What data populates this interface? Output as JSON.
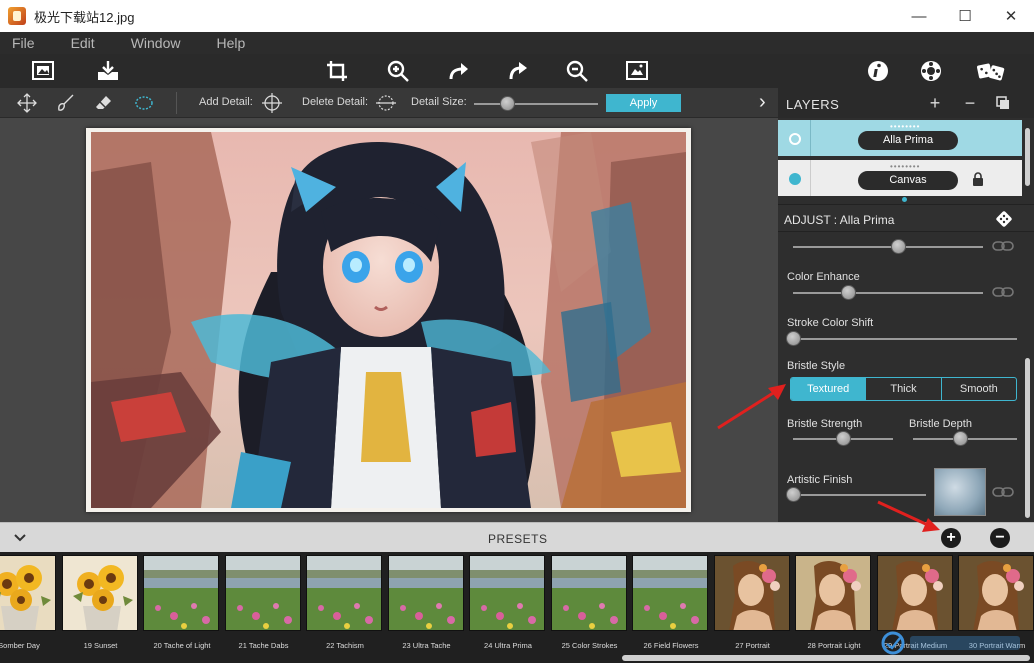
{
  "window": {
    "title": "极光下载站12.jpg",
    "min_glyph": "—",
    "max_glyph": "☐",
    "close_glyph": "✕"
  },
  "menu": [
    "File",
    "Edit",
    "Window",
    "Help"
  ],
  "toolbar_icons": [
    "open-image-icon",
    "save-icon",
    "crop-icon",
    "zoom-in-icon",
    "undo-icon",
    "redo-icon",
    "zoom-out-icon",
    "fit-image-icon",
    "info-icon",
    "settings-icon",
    "random-dice-icon"
  ],
  "subbar": {
    "add_detail": "Add Detail:",
    "delete_detail": "Delete Detail:",
    "detail_size": "Detail Size:",
    "detail_size_value": 0.27,
    "apply": "Apply",
    "expand_glyph": "›"
  },
  "layers": {
    "title": "LAYERS",
    "add_glyph": "+",
    "remove_glyph": "−",
    "items": [
      {
        "name": "Alla Prima",
        "selected": true
      },
      {
        "name": "Canvas",
        "selected": false,
        "locked": true
      }
    ]
  },
  "adjust": {
    "title": "ADJUST : Alla Prima",
    "sliders": [
      {
        "label": "",
        "value": 0.55
      },
      {
        "label": "Color Enhance",
        "value": 0.29
      },
      {
        "label": "Stroke Color Shift",
        "value": 0.0
      }
    ],
    "bristle_style": {
      "label": "Bristle Style",
      "options": [
        "Textured",
        "Thick",
        "Smooth"
      ],
      "selected": "Textured"
    },
    "bristle_strength": {
      "label": "Bristle Strength",
      "value": 0.5
    },
    "bristle_depth": {
      "label": "Bristle Depth",
      "value": 0.45
    },
    "artistic_finish": {
      "label": "Artistic Finish",
      "value": 0.0
    }
  },
  "presets": {
    "title": "PRESETS",
    "add_glyph": "+",
    "remove_glyph": "−",
    "items": [
      {
        "label": "Somber Day",
        "kind": "sunflower"
      },
      {
        "label": "19 Sunset",
        "kind": "sunflower-light"
      },
      {
        "label": "20 Tache of Light",
        "kind": "field"
      },
      {
        "label": "21 Tache Dabs",
        "kind": "field"
      },
      {
        "label": "22 Tachism",
        "kind": "field"
      },
      {
        "label": "23 Ultra Tache",
        "kind": "field"
      },
      {
        "label": "24 Ultra Prima",
        "kind": "field"
      },
      {
        "label": "25 Color Strokes",
        "kind": "field"
      },
      {
        "label": "26 Field Flowers",
        "kind": "field"
      },
      {
        "label": "27 Portrait",
        "kind": "portrait"
      },
      {
        "label": "28 Portrait Light",
        "kind": "portrait-light"
      },
      {
        "label": "29 Portrait Medium",
        "kind": "portrait"
      },
      {
        "label": "30 Portrait Warm",
        "kind": "portrait"
      }
    ]
  },
  "colors": {
    "accent": "#3fb6cf",
    "arrow": "#e0201e"
  }
}
